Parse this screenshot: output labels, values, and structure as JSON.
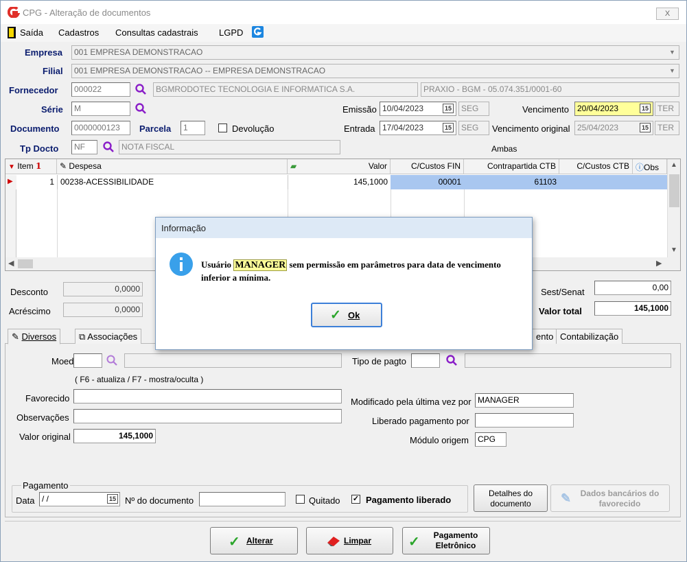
{
  "window": {
    "title": "CPG - Alteração de documentos",
    "close": "X"
  },
  "menu": {
    "exit": "Saída",
    "items": [
      "Cadastros",
      "Consultas cadastrais",
      "LGPD"
    ]
  },
  "form": {
    "empresa_label": "Empresa",
    "empresa_value": "001 EMPRESA DEMONSTRACAO",
    "filial_label": "Filial",
    "filial_value": "001 EMPRESA DEMONSTRACAO -- EMPRESA DEMONSTRACAO",
    "fornecedor_label": "Fornecedor",
    "fornecedor_code": "000022",
    "fornecedor_name": "BGMRODOTEC TECNOLOGIA E INFORMATICA S.A.",
    "fornecedor_extra": "PRAXIO - BGM - 05.074.351/0001-60",
    "serie_label": "Série",
    "serie_value": "M",
    "emissao_label": "Emissão",
    "emissao_value": "10/04/2023",
    "emissao_day": "SEG",
    "vencimento_label": "Vencimento",
    "vencimento_value": "20/04/2023",
    "vencimento_day": "TER",
    "documento_label": "Documento",
    "documento_value": "0000000123",
    "parcela_label": "Parcela",
    "parcela_value": "1",
    "devolucao_label": "Devolução",
    "entrada_label": "Entrada",
    "entrada_value": "17/04/2023",
    "entrada_day": "SEG",
    "venc_original_label": "Vencimento original",
    "venc_original_value": "25/04/2023",
    "venc_original_day": "TER",
    "tpdocto_label": "Tp Docto",
    "tpdocto_code": "NF",
    "tpdocto_name": "NOTA FISCAL",
    "ambas": "Ambas",
    "calendar_glyph": "15"
  },
  "grid": {
    "headers": {
      "item": "Item",
      "sort": "1",
      "despesa": "Despesa",
      "valor": "Valor",
      "cc_fin": "C/Custos FIN",
      "contrapartida": "Contrapartida CTB",
      "cc_ctb": "C/Custos CTB",
      "obs": "Obs"
    },
    "rows": [
      {
        "item": "1",
        "despesa": "00238-ACESSIBILIDADE",
        "valor": "145,1000",
        "cc_fin": "00001",
        "contrapartida": "61103"
      }
    ]
  },
  "totals": {
    "desconto_label": "Desconto",
    "desconto_value": "0,0000",
    "acrescimo_label": "Acréscimo",
    "acrescimo_value": "0,0000",
    "sest_label": "Sest/Senat",
    "sest_value": "0,00",
    "total_label": "Valor total",
    "total_value": "145,1000"
  },
  "tabs": {
    "diversos": "Diversos",
    "associacoes": "Associações",
    "pagamento_partial": "ento",
    "contabilizacao": "Contabilização"
  },
  "diversos": {
    "moeda_label": "Moeda",
    "f6_hint": "( F6 - atualiza / F7 - mostra/oculta )",
    "favorecido_label": "Favorecido",
    "observacoes_label": "Observações",
    "valor_original_label": "Valor original",
    "valor_original_value": "145,1000",
    "tipo_pagto_label": "Tipo de pagto",
    "modificado_label": "Modificado pela última vez por",
    "modificado_value": "MANAGER",
    "liberado_label": "Liberado pagamento por",
    "modulo_label": "Módulo origem",
    "modulo_value": "CPG",
    "pagamento_group": "Pagamento",
    "data_label": "Data",
    "data_value": " / /",
    "ndoc_label": "Nº do documento",
    "quitado_label": "Quitado",
    "pag_liberado_label": "Pagamento liberado",
    "detalhes_btn": "Detalhes do documento",
    "dados_bancarios_btn": "Dados bancários do favorecido"
  },
  "buttons": {
    "alterar": "Alterar",
    "limpar": "Limpar",
    "pag_eletronico": "Pagamento Eletrônico"
  },
  "dialog": {
    "title": "Informação",
    "msg_prefix": "Usuário",
    "msg_user": "MANAGER",
    "msg_suffix": "sem permissão em parâmetros para data de vencimento inferior a mínima.",
    "ok": "Ok"
  },
  "colors": {
    "accent": "#0a1c6e",
    "highlight": "#ffff9a",
    "grid_selection": "#a9c7f0",
    "info_icon": "#39a0ea",
    "app_logo": "#e0302a"
  }
}
